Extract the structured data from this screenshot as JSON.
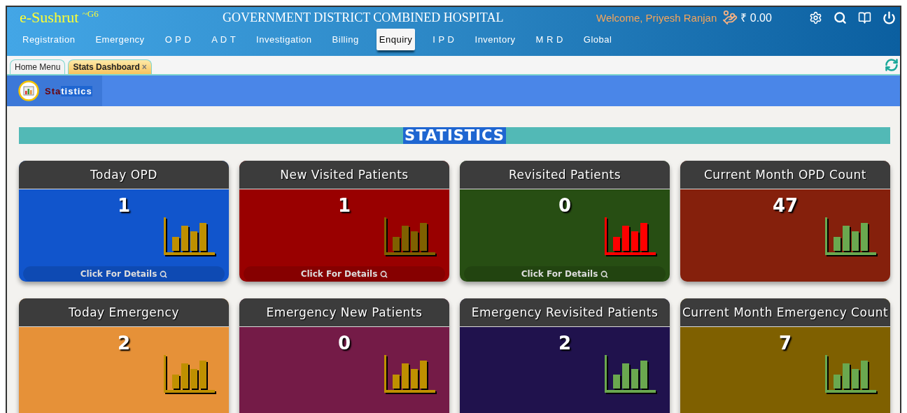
{
  "header": {
    "brand": "e-Sushrut",
    "brand_suffix": "~G6",
    "hospital": "GOVERNMENT DISTRICT COMBINED HOSPITAL",
    "welcome": "Welcome, Priyesh Ranjan",
    "balance": "₹ 0.00"
  },
  "menu": [
    {
      "label": "Registration",
      "selected": false
    },
    {
      "label": "Emergency",
      "selected": false
    },
    {
      "label": "O P D",
      "selected": false
    },
    {
      "label": "A D T",
      "selected": false
    },
    {
      "label": "Investigation",
      "selected": false
    },
    {
      "label": "Billing",
      "selected": false
    },
    {
      "label": "Enquiry",
      "selected": true
    },
    {
      "label": "I P D",
      "selected": false
    },
    {
      "label": "Inventory",
      "selected": false
    },
    {
      "label": "M R D",
      "selected": false
    },
    {
      "label": "Global",
      "selected": false
    }
  ],
  "tabs": [
    {
      "label": "Home Menu",
      "selected": false
    },
    {
      "label": "Stats Dashboard",
      "selected": true,
      "close": "×"
    }
  ],
  "section": {
    "title": "Statistics",
    "text_selected": true
  },
  "banner": {
    "title": "STATISTICS",
    "text_selected": true
  },
  "cards": [
    {
      "title": "Today OPD",
      "value": "1",
      "color": "#1155cc",
      "chart": {
        "color": "#bf9000"
      },
      "details": "Click For Details"
    },
    {
      "title": "New Visited Patients",
      "value": "1",
      "color": "#990000",
      "chart": {
        "color": "#7f6000"
      },
      "details": "Click For Details"
    },
    {
      "title": "Revisited Patients",
      "value": "0",
      "color": "#274e13",
      "chart": {
        "color": "#ff0000"
      },
      "details": "Click For Details"
    },
    {
      "title": "Current Month OPD Count",
      "value": "47",
      "color": "#85200c",
      "chart": {
        "color": "#6aa84f"
      }
    },
    {
      "title": "Today Emergency",
      "value": "2",
      "color": "#e69138",
      "chart": {
        "color": "#bf9000"
      }
    },
    {
      "title": "Emergency New Patients",
      "value": "0",
      "color": "#741b47",
      "chart": {
        "color": "#bf9000"
      }
    },
    {
      "title": "Emergency Revisited Patients",
      "value": "2",
      "color": "#20124d",
      "chart": {
        "color": "#6aa84f"
      }
    },
    {
      "title": "Current Month Emergency Count",
      "value": "7",
      "color": "#7f6000",
      "chart": {
        "color": "#6aa84f"
      }
    }
  ]
}
